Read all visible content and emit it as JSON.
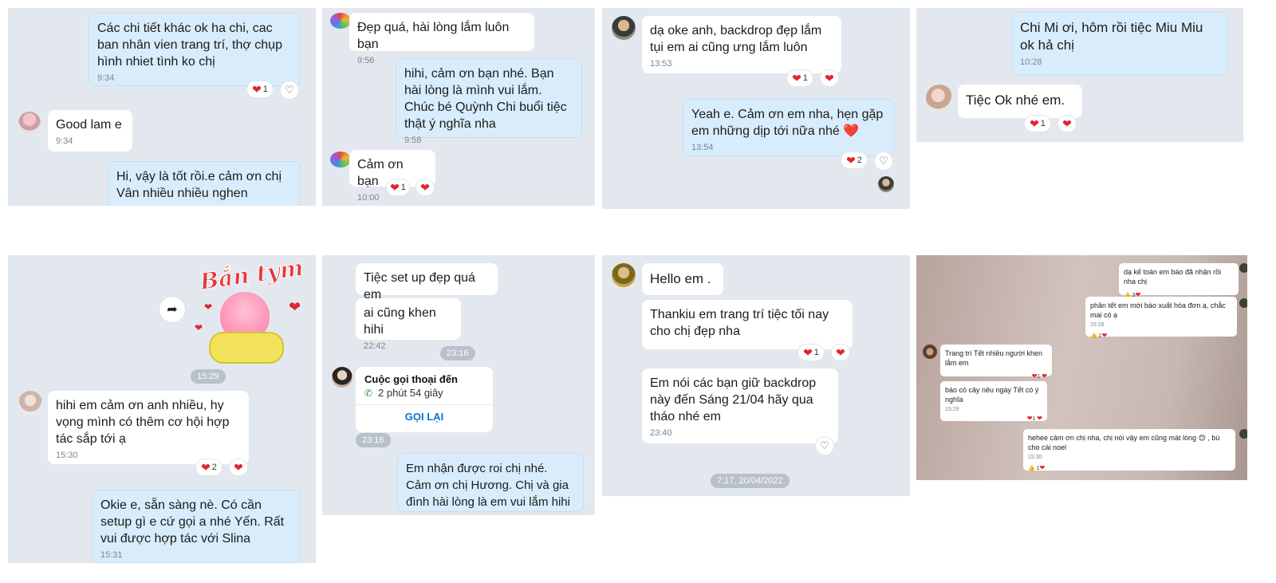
{
  "p1": {
    "m1": {
      "text": "Các chi tiết khác ok ha chi, cac ban nhân vien trang trí, thợ chụp hình nhiet tình ko chị",
      "time": "9:34",
      "react_count": "1"
    },
    "m2": {
      "text": "Good lam e",
      "time": "9:34"
    },
    "m3": {
      "text": "Hi, vậy là tốt rồi.e cảm ơn chị Vân nhiều nhiều nghen"
    }
  },
  "p2": {
    "m1": {
      "text": "Đẹp quá, hài lòng lắm luôn bạn",
      "time": "9:56"
    },
    "m2": {
      "text": "hihi, cảm ơn bạn nhé. Bạn hài lòng là mình vui lắm. Chúc bé Quỳnh Chi buổi tiệc thật ý nghĩa nha",
      "time": "9:58"
    },
    "m3": {
      "text": "Cảm ơn bạn",
      "time": "10:00",
      "react_count": "1"
    }
  },
  "p3": {
    "m1": {
      "text": "dạ oke anh, backdrop đẹp lắm tụi em ai cũng ưng lắm luôn",
      "time": "13:53",
      "react_count": "1"
    },
    "m2": {
      "text": "Yeah e. Cảm ơn em nha, hẹn gặp em những dịp tới nữa nhé ❤️",
      "time": "13:54",
      "react_count": "2"
    }
  },
  "p4": {
    "m1": {
      "text": "Chi Mi ơi, hôm rồi tiệc Miu Miu ok hả chị",
      "time": "10:28"
    },
    "m2": {
      "text": "Tiệc Ok nhé em.",
      "react_count": "1"
    }
  },
  "p5": {
    "sticker_text": "Bắn tym",
    "time_pill": "15:29",
    "m1": {
      "text": "hihi em cảm ơn anh nhiều, hy vọng mình có thêm cơ hội hợp tác sắp tới ạ",
      "time": "15:30",
      "react_count": "2"
    },
    "m2": {
      "text": "Okie e, sẵn sàng nè. Có cần setup gì e cứ gọi a nhé Yến. Rất vui được hợp tác với Slina",
      "time": "15:31"
    }
  },
  "p6": {
    "m1": {
      "text": "Tiệc set up đẹp quá em"
    },
    "m2": {
      "text": "ai cũng khen hihi",
      "time": "22:42"
    },
    "time_pill": "23:16",
    "call": {
      "title": "Cuộc gọi thoại đến",
      "duration": "2 phút 54 giây",
      "action": "GỌI LẠI"
    },
    "call_time": "23:16",
    "m3": {
      "text": "Em nhận được roi chị nhé. Cảm ơn chị Hương. Chị và gia đình hài lòng là em vui lắm hihi"
    }
  },
  "p7": {
    "m1": {
      "text": "Hello em ."
    },
    "m2": {
      "text": "Thankiu em trang trí tiệc tối nay cho chị đẹp nha",
      "react_count": "1"
    },
    "m3": {
      "text": "Em nói các bạn giữ backdrop này đến Sáng 21/04 hãy qua tháo nhé em",
      "time": "23:40"
    },
    "date_pill": "7:17, 20/04/2022"
  },
  "p8": {
    "m1": {
      "text": "dạ kế toán em báo đã nhận rồi nha chị",
      "react_count": "3"
    },
    "m2": {
      "text": "phần tết em mới báo xuất hóa đơn ạ, chắc mai có ạ",
      "time": "15:28",
      "react_count": "1"
    },
    "m3": {
      "text": "Trang trí Tết nhiều người khen lắm em",
      "react_count": "1"
    },
    "m4": {
      "text": "báo có cây nêu ngày Tết có ý nghĩa",
      "time": "15:29",
      "react_count": "1"
    },
    "m5": {
      "text": "hehee cảm ơn chị nha, chị nói vậy em cũng mát lòng 😊 , bù cho cái noel",
      "time": "15:30",
      "react_count": "1"
    }
  },
  "colors": {
    "panel_bg": "#e3e8ef",
    "outgoing_bubble": "#d9ecfb",
    "incoming_bubble": "#ffffff",
    "heart": "#e0262f",
    "call_action": "#0b74d1"
  }
}
